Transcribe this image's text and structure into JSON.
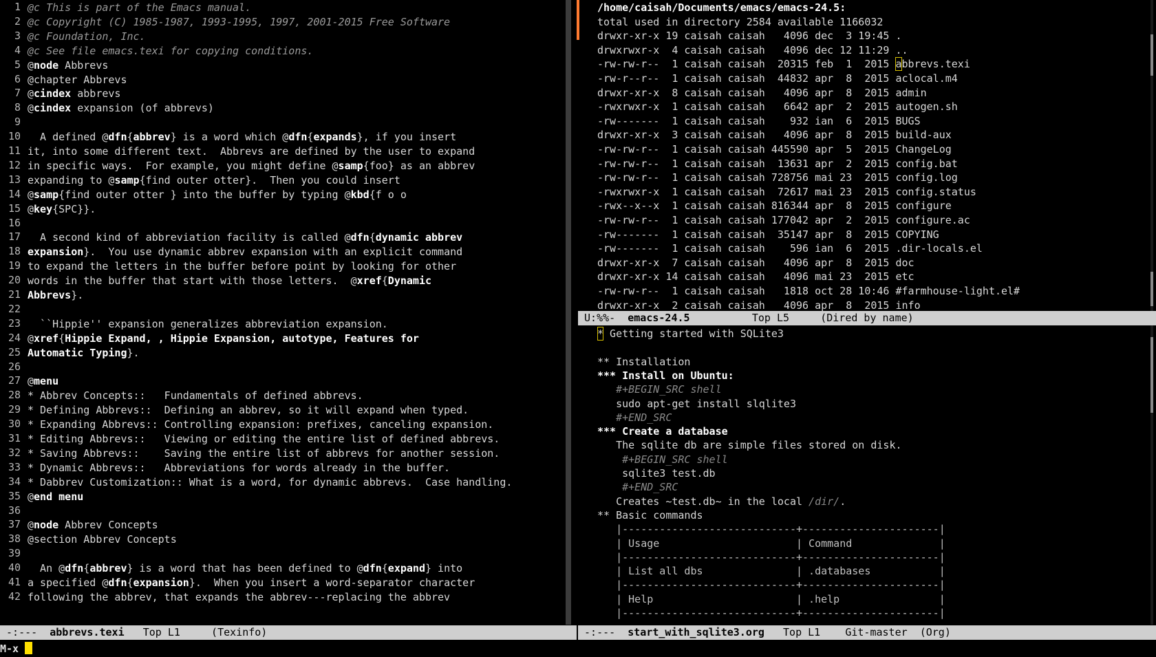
{
  "left": {
    "line_numbers": [
      "1",
      "2",
      "3",
      "4",
      "5",
      "6",
      "7",
      "8",
      "9",
      "10",
      "11",
      "12",
      "13",
      "14",
      "15",
      "16",
      "17",
      "18",
      "19",
      "20",
      "21",
      "22",
      "23",
      "24",
      "25",
      "26",
      "27",
      "28",
      "29",
      "30",
      "31",
      "32",
      "33",
      "34",
      "35",
      "36",
      "37",
      "38",
      "39",
      "40",
      "41",
      "42"
    ],
    "lines": [
      [
        {
          "t": "@c This is part of the Emacs manual.",
          "c": "comment"
        }
      ],
      [
        {
          "t": "@c Copyright (C) 1985-1987, 1993-1995, 1997, 2001-2015 Free Software",
          "c": "comment"
        }
      ],
      [
        {
          "t": "@c Foundation, Inc.",
          "c": "comment"
        }
      ],
      [
        {
          "t": "@c See file emacs.texi for copying conditions.",
          "c": "comment"
        }
      ],
      [
        {
          "t": "@"
        },
        {
          "t": "node",
          "c": "kw"
        },
        {
          "t": " Abbrevs"
        }
      ],
      [
        {
          "t": "@chapter Abbrevs"
        }
      ],
      [
        {
          "t": "@"
        },
        {
          "t": "cindex",
          "c": "kw"
        },
        {
          "t": " abbrevs"
        }
      ],
      [
        {
          "t": "@"
        },
        {
          "t": "cindex",
          "c": "kw"
        },
        {
          "t": " expansion (of abbrevs)"
        }
      ],
      [
        {
          "t": ""
        }
      ],
      [
        {
          "t": "  A defined @"
        },
        {
          "t": "dfn",
          "c": "kw"
        },
        {
          "t": "{"
        },
        {
          "t": "abbrev",
          "c": "kw"
        },
        {
          "t": "} is a word which @"
        },
        {
          "t": "dfn",
          "c": "kw"
        },
        {
          "t": "{"
        },
        {
          "t": "expands",
          "c": "kw"
        },
        {
          "t": "}, if you insert"
        }
      ],
      [
        {
          "t": "it, into some different text.  Abbrevs are defined by the user to expand"
        }
      ],
      [
        {
          "t": "in specific ways.  For example, you might define @"
        },
        {
          "t": "samp",
          "c": "kw"
        },
        {
          "t": "{foo} as an abbrev"
        }
      ],
      [
        {
          "t": "expanding to @"
        },
        {
          "t": "samp",
          "c": "kw"
        },
        {
          "t": "{find outer otter}.  Then you could insert"
        }
      ],
      [
        {
          "t": "@"
        },
        {
          "t": "samp",
          "c": "kw"
        },
        {
          "t": "{find outer otter } into the buffer by typing @"
        },
        {
          "t": "kbd",
          "c": "kw"
        },
        {
          "t": "{f o o"
        }
      ],
      [
        {
          "t": "@"
        },
        {
          "t": "key",
          "c": "kw"
        },
        {
          "t": "{SPC}}."
        }
      ],
      [
        {
          "t": ""
        }
      ],
      [
        {
          "t": "  A second kind of abbreviation facility is called @"
        },
        {
          "t": "dfn",
          "c": "kw"
        },
        {
          "t": "{"
        },
        {
          "t": "dynamic abbrev",
          "c": "kw"
        }
      ],
      [
        {
          "t": "expansion",
          "c": "kw"
        },
        {
          "t": "}.  You use dynamic abbrev expansion with an explicit command"
        }
      ],
      [
        {
          "t": "to expand the letters in the buffer before point by looking for other"
        }
      ],
      [
        {
          "t": "words in the buffer that start with those letters.  @"
        },
        {
          "t": "xref",
          "c": "kw"
        },
        {
          "t": "{"
        },
        {
          "t": "Dynamic",
          "c": "kw"
        }
      ],
      [
        {
          "t": "Abbrevs",
          "c": "kw"
        },
        {
          "t": "}."
        }
      ],
      [
        {
          "t": ""
        }
      ],
      [
        {
          "t": "  ``Hippie'' expansion generalizes abbreviation expansion."
        }
      ],
      [
        {
          "t": "@"
        },
        {
          "t": "xref",
          "c": "kw"
        },
        {
          "t": "{"
        },
        {
          "t": "Hippie Expand, , Hippie Expansion, autotype, Features for",
          "c": "kw"
        }
      ],
      [
        {
          "t": "Automatic Typing",
          "c": "kw"
        },
        {
          "t": "}."
        }
      ],
      [
        {
          "t": ""
        }
      ],
      [
        {
          "t": "@"
        },
        {
          "t": "menu",
          "c": "kw"
        }
      ],
      [
        {
          "t": "* Abbrev Concepts::   Fundamentals of defined abbrevs."
        }
      ],
      [
        {
          "t": "* Defining Abbrevs::  Defining an abbrev, so it will expand when typed."
        }
      ],
      [
        {
          "t": "* Expanding Abbrevs:: Controlling expansion: prefixes, canceling expansion."
        }
      ],
      [
        {
          "t": "* Editing Abbrevs::   Viewing or editing the entire list of defined abbrevs."
        }
      ],
      [
        {
          "t": "* Saving Abbrevs::    Saving the entire list of abbrevs for another session."
        }
      ],
      [
        {
          "t": "* Dynamic Abbrevs::   Abbreviations for words already in the buffer."
        }
      ],
      [
        {
          "t": "* Dabbrev Customization:: What is a word, for dynamic abbrevs.  Case handling."
        }
      ],
      [
        {
          "t": "@"
        },
        {
          "t": "end menu",
          "c": "kw"
        }
      ],
      [
        {
          "t": ""
        }
      ],
      [
        {
          "t": "@"
        },
        {
          "t": "node",
          "c": "kw"
        },
        {
          "t": " Abbrev Concepts"
        }
      ],
      [
        {
          "t": "@section Abbrev Concepts"
        }
      ],
      [
        {
          "t": ""
        }
      ],
      [
        {
          "t": "  An @"
        },
        {
          "t": "dfn",
          "c": "kw"
        },
        {
          "t": "{"
        },
        {
          "t": "abbrev",
          "c": "kw"
        },
        {
          "t": "} is a word that has been defined to @"
        },
        {
          "t": "dfn",
          "c": "kw"
        },
        {
          "t": "{"
        },
        {
          "t": "expand",
          "c": "kw"
        },
        {
          "t": "} into"
        }
      ],
      [
        {
          "t": "a specified @"
        },
        {
          "t": "dfn",
          "c": "kw"
        },
        {
          "t": "{"
        },
        {
          "t": "expansion",
          "c": "kw"
        },
        {
          "t": "}.  When you insert a word-separator character"
        }
      ],
      [
        {
          "t": "following the abbrev, that expands the abbrev---replacing the abbrev"
        }
      ]
    ]
  },
  "right_top": {
    "lines": [
      [
        {
          "t": "/home/caisah/Documents/emacs/emacs-24.5:",
          "c": "heading"
        }
      ],
      [
        {
          "t": "total used in directory 2584 available 1166032"
        }
      ],
      [
        {
          "t": "drwxr-xr-x 19 caisah caisah   4096 dec  3 19:45 ."
        }
      ],
      [
        {
          "t": "drwxrwxr-x  4 caisah caisah   4096 dec 12 11:29 .."
        }
      ],
      [
        {
          "t": "-rw-rw-r--  1 caisah caisah  20315 feb  1  2015 "
        },
        {
          "t": "a",
          "c": "cursor"
        },
        {
          "t": "bbrevs.texi"
        }
      ],
      [
        {
          "t": "-rw-r--r--  1 caisah caisah  44832 apr  8  2015 aclocal.m4"
        }
      ],
      [
        {
          "t": "drwxr-xr-x  8 caisah caisah   4096 apr  8  2015 admin"
        }
      ],
      [
        {
          "t": "-rwxrwxr-x  1 caisah caisah   6642 apr  2  2015 autogen.sh"
        }
      ],
      [
        {
          "t": "-rw-------  1 caisah caisah    932 ian  6  2015 BUGS"
        }
      ],
      [
        {
          "t": "drwxr-xr-x  3 caisah caisah   4096 apr  8  2015 build-aux"
        }
      ],
      [
        {
          "t": "-rw-rw-r--  1 caisah caisah 445590 apr  5  2015 ChangeLog"
        }
      ],
      [
        {
          "t": "-rw-rw-r--  1 caisah caisah  13631 apr  2  2015 config.bat"
        }
      ],
      [
        {
          "t": "-rw-rw-r--  1 caisah caisah 728756 mai 23  2015 config.log"
        }
      ],
      [
        {
          "t": "-rwxrwxr-x  1 caisah caisah  72617 mai 23  2015 config.status"
        }
      ],
      [
        {
          "t": "-rwx--x--x  1 caisah caisah 816344 apr  8  2015 configure"
        }
      ],
      [
        {
          "t": "-rw-rw-r--  1 caisah caisah 177042 apr  2  2015 configure.ac"
        }
      ],
      [
        {
          "t": "-rw-------  1 caisah caisah  35147 apr  8  2015 COPYING"
        }
      ],
      [
        {
          "t": "-rw-------  1 caisah caisah    596 ian  6  2015 .dir-locals.el"
        }
      ],
      [
        {
          "t": "drwxr-xr-x  7 caisah caisah   4096 apr  8  2015 doc"
        }
      ],
      [
        {
          "t": "drwxr-xr-x 14 caisah caisah   4096 mai 23  2015 etc"
        }
      ],
      [
        {
          "t": "-rw-rw-r--  1 caisah caisah   1818 oct 28 10:46 #farmhouse-light.el#"
        }
      ],
      [
        {
          "t": "drwxr-xr-x  2 caisah caisah   4096 apr  8  2015 info"
        }
      ]
    ]
  },
  "right_bottom": {
    "lines": [
      [
        {
          "t": "*",
          "c": "cursor"
        },
        {
          "t": " Getting started with SQLite3"
        }
      ],
      [
        {
          "t": ""
        }
      ],
      [
        {
          "t": "** Installation"
        }
      ],
      [
        {
          "t": "*** Install on Ubuntu:",
          "c": "heading"
        }
      ],
      [
        {
          "t": "   #+BEGIN_SRC shell",
          "c": "dim"
        }
      ],
      [
        {
          "t": "   sudo apt-get install slqlite3"
        }
      ],
      [
        {
          "t": "   #+END_SRC",
          "c": "dim"
        }
      ],
      [
        {
          "t": "*** Create a database",
          "c": "heading"
        }
      ],
      [
        {
          "t": "   The sqlite db are simple files stored on disk."
        }
      ],
      [
        {
          "t": "    #+BEGIN_SRC shell",
          "c": "dim"
        }
      ],
      [
        {
          "t": "    sqlite3 test.db"
        }
      ],
      [
        {
          "t": "    #+END_SRC",
          "c": "dim"
        }
      ],
      [
        {
          "t": "   Creates ~test.db~ in the local "
        },
        {
          "t": "/dir/",
          "c": "dim"
        },
        {
          "t": "."
        }
      ],
      [
        {
          "t": "** Basic commands"
        }
      ],
      [
        {
          "t": "   |----------------------------+----------------------|",
          "c": "table"
        }
      ],
      [
        {
          "t": "   | Usage                      | Command              |",
          "c": "table"
        }
      ],
      [
        {
          "t": "   |----------------------------+----------------------|",
          "c": "table"
        }
      ],
      [
        {
          "t": "   | List all dbs               | .databases           |",
          "c": "table"
        }
      ],
      [
        {
          "t": "   |----------------------------+----------------------|",
          "c": "table"
        }
      ],
      [
        {
          "t": "   | Help                       | .help                |",
          "c": "table"
        }
      ],
      [
        {
          "t": "   |----------------------------+----------------------|",
          "c": "table"
        }
      ]
    ]
  },
  "modelines": {
    "left": {
      "state": " -:---  ",
      "buffer": "abbrevs.texi",
      "rest": "   Top L1     (Texinfo)"
    },
    "right_top": {
      "state": " U:%%-  ",
      "buffer": "emacs-24.5",
      "rest": "          Top L5     (Dired by name)"
    },
    "right_bottom": {
      "state": " -:---  ",
      "buffer": "start_with_sqlite3.org",
      "rest": "   Top L1    Git-master  (Org)"
    }
  },
  "minibuffer": {
    "prompt": "M-x "
  }
}
